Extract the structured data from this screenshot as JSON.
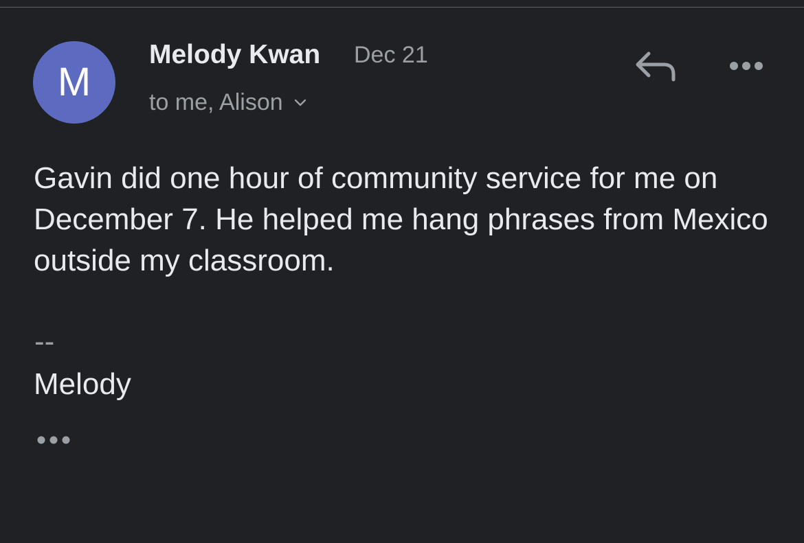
{
  "email": {
    "sender_initial": "M",
    "sender_name": "Melody Kwan",
    "date": "Dec 21",
    "recipients": "to me, Alison",
    "body": "Gavin did one hour of community service for me on December 7. He helped me hang phrases from Mexico outside my classroom.",
    "signature_separator": "--",
    "signature_name": "Melody"
  },
  "icons": {
    "reply": "reply-icon",
    "more": "more-horizontal-icon",
    "expand_recipients": "chevron-down-icon",
    "show_trimmed": "more-horizontal-icon"
  },
  "colors": {
    "background": "#202124",
    "avatar": "#5c6bc0",
    "primary_text": "#e8eaed",
    "secondary_text": "#9aa0a6"
  }
}
